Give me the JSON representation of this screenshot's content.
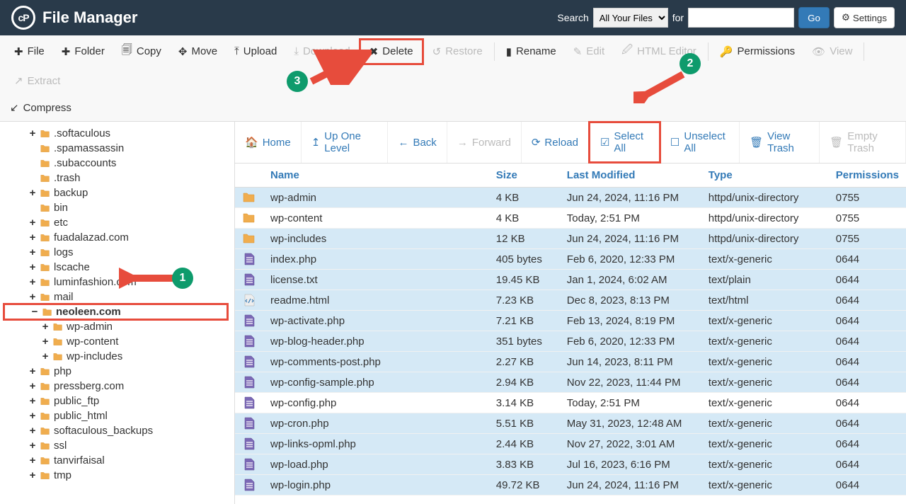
{
  "header": {
    "title": "File Manager",
    "search_label": "Search",
    "search_scope": "All Your Files",
    "for_label": "for",
    "go_label": "Go",
    "settings_label": "Settings"
  },
  "toolbar": {
    "file": "File",
    "folder": "Folder",
    "copy": "Copy",
    "move": "Move",
    "upload": "Upload",
    "download": "Download",
    "delete": "Delete",
    "restore": "Restore",
    "rename": "Rename",
    "edit": "Edit",
    "html_editor": "HTML Editor",
    "permissions": "Permissions",
    "view": "View",
    "extract": "Extract",
    "compress": "Compress"
  },
  "actionbar": {
    "home": "Home",
    "up": "Up One Level",
    "back": "Back",
    "forward": "Forward",
    "reload": "Reload",
    "select_all": "Select All",
    "unselect_all": "Unselect All",
    "view_trash": "View Trash",
    "empty_trash": "Empty Trash"
  },
  "columns": {
    "name": "Name",
    "size": "Size",
    "modified": "Last Modified",
    "type": "Type",
    "permissions": "Permissions"
  },
  "tree": [
    {
      "indent": 2,
      "exp": "+",
      "name": ".softaculous"
    },
    {
      "indent": 2,
      "exp": "",
      "name": ".spamassassin"
    },
    {
      "indent": 2,
      "exp": "",
      "name": ".subaccounts"
    },
    {
      "indent": 2,
      "exp": "",
      "name": ".trash"
    },
    {
      "indent": 2,
      "exp": "+",
      "name": "backup"
    },
    {
      "indent": 2,
      "exp": "",
      "name": "bin"
    },
    {
      "indent": 2,
      "exp": "+",
      "name": "etc"
    },
    {
      "indent": 2,
      "exp": "+",
      "name": "fuadalazad.com"
    },
    {
      "indent": 2,
      "exp": "+",
      "name": "logs"
    },
    {
      "indent": 2,
      "exp": "+",
      "name": "lscache"
    },
    {
      "indent": 2,
      "exp": "+",
      "name": "luminfashion.com"
    },
    {
      "indent": 2,
      "exp": "+",
      "name": "mail"
    },
    {
      "indent": 2,
      "exp": "−",
      "name": "neoleen.com",
      "highlighted": true
    },
    {
      "indent": 3,
      "exp": "+",
      "name": "wp-admin"
    },
    {
      "indent": 3,
      "exp": "+",
      "name": "wp-content"
    },
    {
      "indent": 3,
      "exp": "+",
      "name": "wp-includes"
    },
    {
      "indent": 2,
      "exp": "+",
      "name": "php"
    },
    {
      "indent": 2,
      "exp": "+",
      "name": "pressberg.com"
    },
    {
      "indent": 2,
      "exp": "+",
      "name": "public_ftp"
    },
    {
      "indent": 2,
      "exp": "+",
      "name": "public_html"
    },
    {
      "indent": 2,
      "exp": "+",
      "name": "softaculous_backups"
    },
    {
      "indent": 2,
      "exp": "+",
      "name": "ssl"
    },
    {
      "indent": 2,
      "exp": "+",
      "name": "tanvirfaisal"
    },
    {
      "indent": 2,
      "exp": "+",
      "name": "tmp"
    }
  ],
  "rows": [
    {
      "icon": "folder",
      "name": "wp-admin",
      "size": "4 KB",
      "modified": "Jun 24, 2024, 11:16 PM",
      "type": "httpd/unix-directory",
      "perm": "0755",
      "selected": true
    },
    {
      "icon": "folder",
      "name": "wp-content",
      "size": "4 KB",
      "modified": "Today, 2:51 PM",
      "type": "httpd/unix-directory",
      "perm": "0755",
      "selected": false
    },
    {
      "icon": "folder",
      "name": "wp-includes",
      "size": "12 KB",
      "modified": "Jun 24, 2024, 11:16 PM",
      "type": "httpd/unix-directory",
      "perm": "0755",
      "selected": true
    },
    {
      "icon": "file",
      "name": "index.php",
      "size": "405 bytes",
      "modified": "Feb 6, 2020, 12:33 PM",
      "type": "text/x-generic",
      "perm": "0644",
      "selected": true
    },
    {
      "icon": "file",
      "name": "license.txt",
      "size": "19.45 KB",
      "modified": "Jan 1, 2024, 6:02 AM",
      "type": "text/plain",
      "perm": "0644",
      "selected": true
    },
    {
      "icon": "html",
      "name": "readme.html",
      "size": "7.23 KB",
      "modified": "Dec 8, 2023, 8:13 PM",
      "type": "text/html",
      "perm": "0644",
      "selected": true
    },
    {
      "icon": "file",
      "name": "wp-activate.php",
      "size": "7.21 KB",
      "modified": "Feb 13, 2024, 8:19 PM",
      "type": "text/x-generic",
      "perm": "0644",
      "selected": true
    },
    {
      "icon": "file",
      "name": "wp-blog-header.php",
      "size": "351 bytes",
      "modified": "Feb 6, 2020, 12:33 PM",
      "type": "text/x-generic",
      "perm": "0644",
      "selected": true
    },
    {
      "icon": "file",
      "name": "wp-comments-post.php",
      "size": "2.27 KB",
      "modified": "Jun 14, 2023, 8:11 PM",
      "type": "text/x-generic",
      "perm": "0644",
      "selected": true
    },
    {
      "icon": "file",
      "name": "wp-config-sample.php",
      "size": "2.94 KB",
      "modified": "Nov 22, 2023, 11:44 PM",
      "type": "text/x-generic",
      "perm": "0644",
      "selected": true
    },
    {
      "icon": "file",
      "name": "wp-config.php",
      "size": "3.14 KB",
      "modified": "Today, 2:51 PM",
      "type": "text/x-generic",
      "perm": "0644",
      "selected": false
    },
    {
      "icon": "file",
      "name": "wp-cron.php",
      "size": "5.51 KB",
      "modified": "May 31, 2023, 12:48 AM",
      "type": "text/x-generic",
      "perm": "0644",
      "selected": true
    },
    {
      "icon": "file",
      "name": "wp-links-opml.php",
      "size": "2.44 KB",
      "modified": "Nov 27, 2022, 3:01 AM",
      "type": "text/x-generic",
      "perm": "0644",
      "selected": true
    },
    {
      "icon": "file",
      "name": "wp-load.php",
      "size": "3.83 KB",
      "modified": "Jul 16, 2023, 6:16 PM",
      "type": "text/x-generic",
      "perm": "0644",
      "selected": true
    },
    {
      "icon": "file",
      "name": "wp-login.php",
      "size": "49.72 KB",
      "modified": "Jun 24, 2024, 11:16 PM",
      "type": "text/x-generic",
      "perm": "0644",
      "selected": true
    }
  ]
}
